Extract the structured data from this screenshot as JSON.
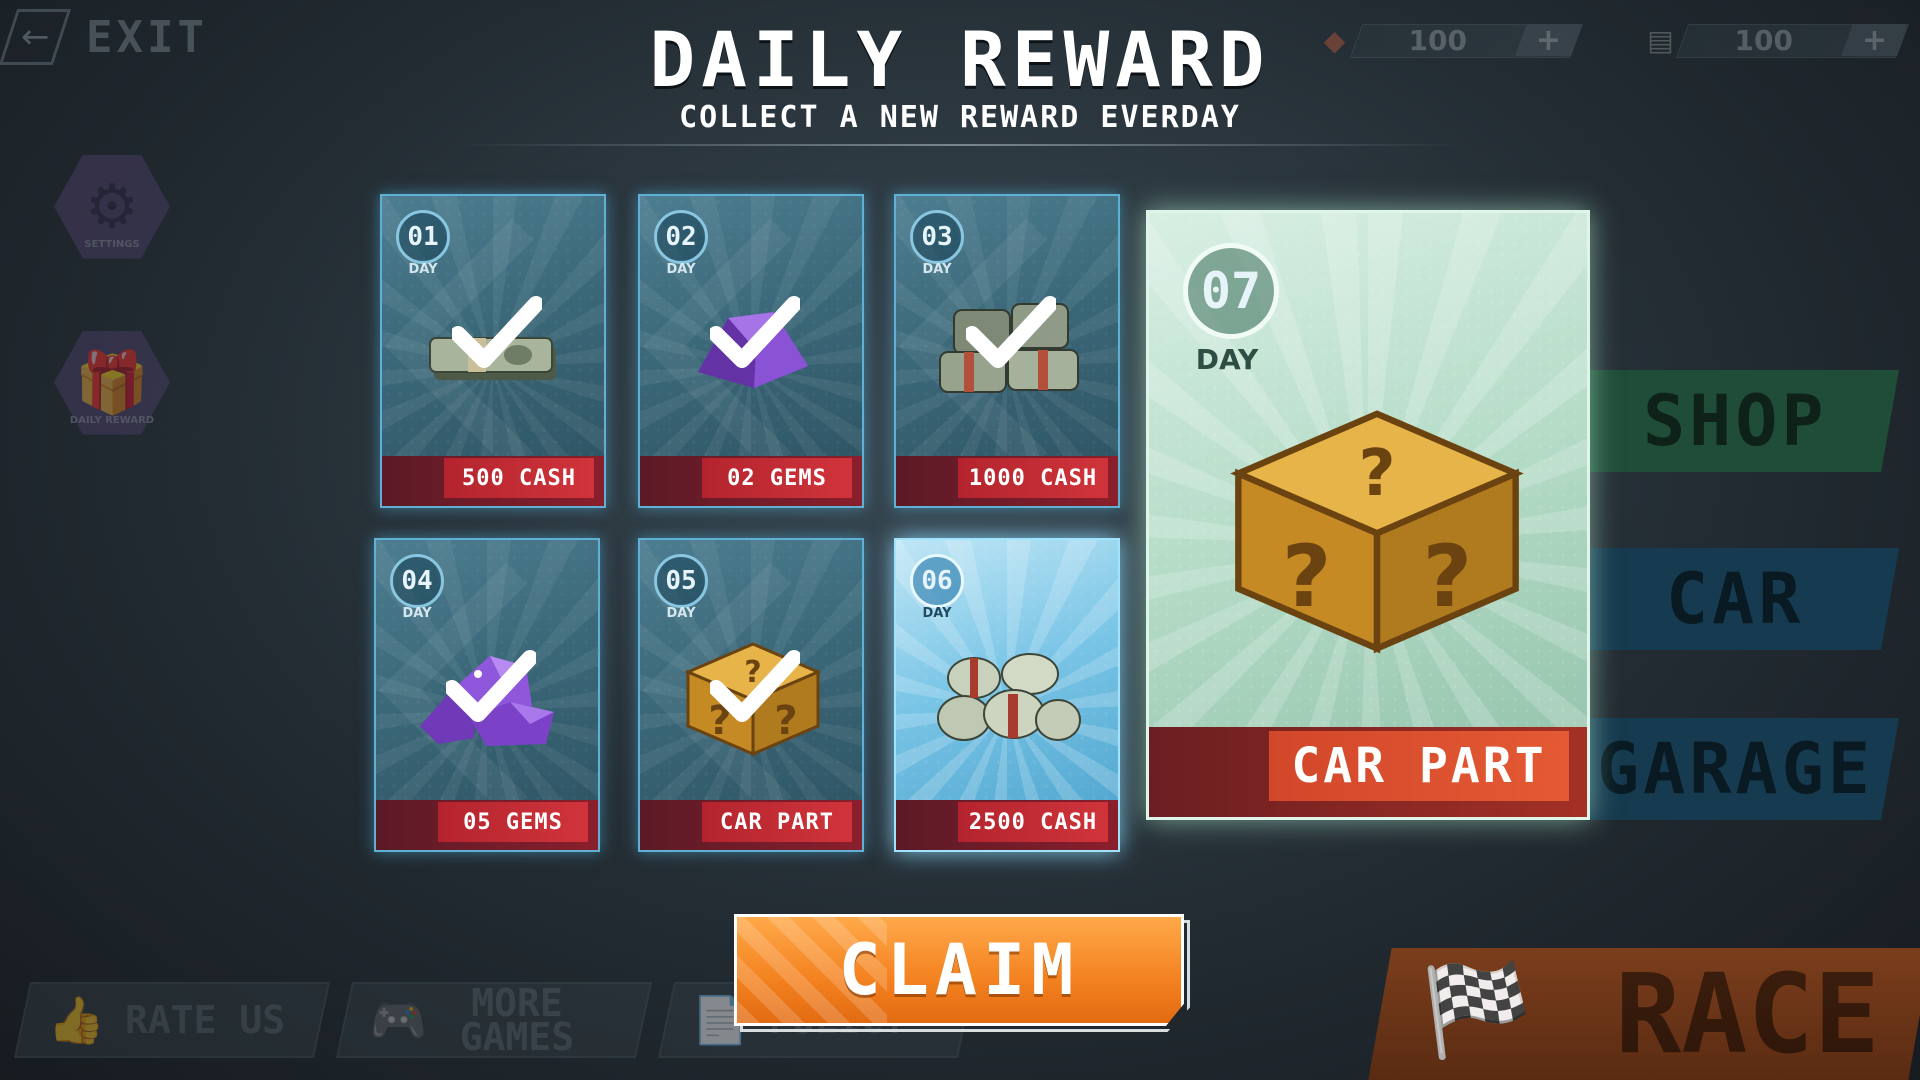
{
  "top_bar": {
    "exit_label": "EXIT",
    "gems": {
      "icon": "gem-icon",
      "amount": "100",
      "plus_label": "+"
    },
    "cash": {
      "icon": "cash-stack-icon",
      "amount": "100",
      "plus_label": "+"
    }
  },
  "side_left": [
    {
      "icon": "gear-icon",
      "label": "SETTINGS"
    },
    {
      "icon": "gift-icon",
      "label": "DAILY REWARD"
    }
  ],
  "side_right": [
    {
      "label": "SHOP",
      "color": "#1f6b4a"
    },
    {
      "label": "CAR",
      "color": "#164d6b"
    },
    {
      "label": "GARAGE",
      "color": "#164d6b"
    }
  ],
  "bottom_bar": {
    "rate_us": "RATE US",
    "more_games": "MORE GAMES",
    "policy": "POLICY",
    "race": "RACE"
  },
  "header": {
    "title": "DAILY REWARD",
    "subtitle": "COLLECT A NEW REWARD EVERDAY"
  },
  "rewards": [
    {
      "day_number": "01",
      "day_label": "DAY",
      "reward": "500 CASH",
      "item": "cash-bundle-icon",
      "claimed": true
    },
    {
      "day_number": "02",
      "day_label": "DAY",
      "reward": "02 GEMS",
      "item": "gem-pile-icon",
      "claimed": true
    },
    {
      "day_number": "03",
      "day_label": "DAY",
      "reward": "1000 CASH",
      "item": "cash-stacks-icon",
      "claimed": true
    },
    {
      "day_number": "04",
      "day_label": "DAY",
      "reward": "05 GEMS",
      "item": "gem-pile-icon",
      "claimed": true
    },
    {
      "day_number": "05",
      "day_label": "DAY",
      "reward": "CAR PART",
      "item": "mystery-box-icon",
      "claimed": true
    },
    {
      "day_number": "06",
      "day_label": "DAY",
      "reward": "2500 CASH",
      "item": "cash-rolls-icon",
      "claimed": false,
      "active": true
    },
    {
      "day_number": "07",
      "day_label": "DAY",
      "reward": "CAR PART",
      "item": "mystery-box-icon",
      "claimed": false
    }
  ],
  "claim_label": "CLAIM",
  "colors": {
    "card_blue": "#3a6778",
    "card_active": "#78c4e6",
    "card_big": "#b7ddc9",
    "label_red": "#c72c34",
    "claim_orange": "#f3811f"
  }
}
